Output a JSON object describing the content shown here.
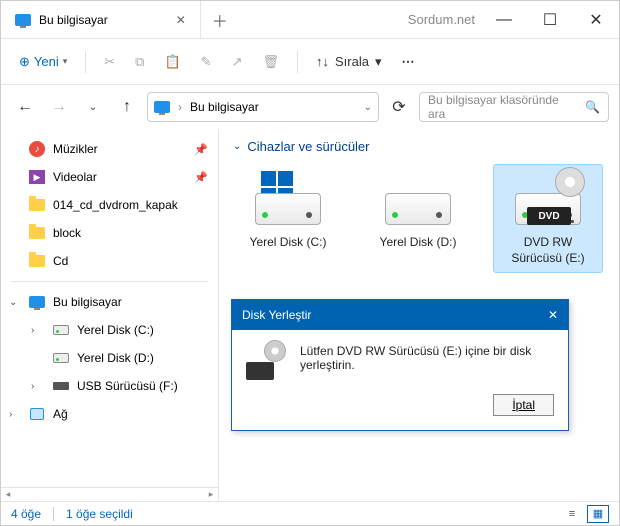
{
  "titlebar": {
    "tab_title": "Bu bilgisayar",
    "watermark": "Sordum.net"
  },
  "toolbar": {
    "new_label": "Yeni",
    "sort_label": "Sırala"
  },
  "address": {
    "location": "Bu bilgisayar"
  },
  "search": {
    "placeholder": "Bu bilgisayar klasöründe ara"
  },
  "sidebar": {
    "quick": [
      {
        "label": "Müzikler"
      },
      {
        "label": "Videolar"
      },
      {
        "label": "014_cd_dvdrom_kapak"
      },
      {
        "label": "block"
      },
      {
        "label": "Cd"
      }
    ],
    "tree": {
      "root": "Bu bilgisayar",
      "children": [
        {
          "label": "Yerel Disk (C:)"
        },
        {
          "label": "Yerel Disk (D:)"
        },
        {
          "label": "USB Sürücüsü (F:)"
        }
      ],
      "network": "Ağ"
    }
  },
  "content": {
    "group_title": "Cihazlar ve sürücüler",
    "drives": [
      {
        "label": "Yerel Disk (C:)"
      },
      {
        "label": "Yerel Disk (D:)"
      },
      {
        "label": "DVD RW Sürücüsü (E:)",
        "badge": "DVD"
      }
    ]
  },
  "dialog": {
    "title": "Disk Yerleştir",
    "message": "Lütfen DVD RW Sürücüsü (E:) içine bir disk yerleştirin.",
    "cancel": "İptal"
  },
  "status": {
    "count": "4 öğe",
    "selected": "1 öğe seçildi"
  }
}
